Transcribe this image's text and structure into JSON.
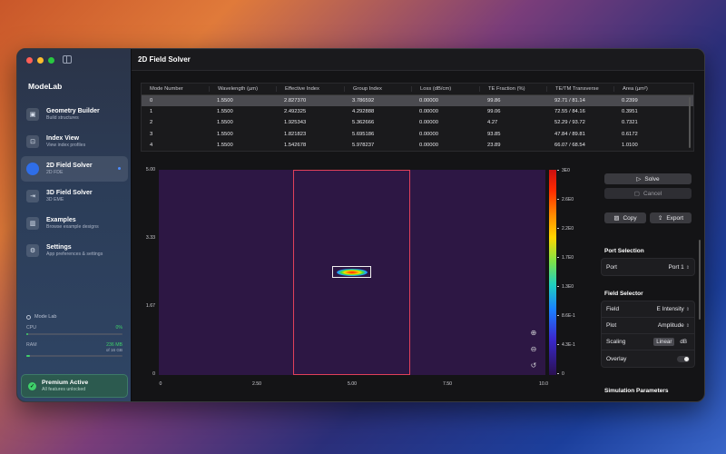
{
  "app": {
    "title": "ModeLab"
  },
  "sidebar": {
    "items": [
      {
        "label": "Geometry Builder",
        "sub": "Build structures",
        "icon": "geometry-icon"
      },
      {
        "label": "Index View",
        "sub": "View index profiles",
        "icon": "index-icon"
      },
      {
        "label": "2D Field Solver",
        "sub": "2D FDE",
        "icon": "solver-icon",
        "active": true
      },
      {
        "label": "3D Field Solver",
        "sub": "3D EME",
        "icon": "solver3d-icon"
      },
      {
        "label": "Examples",
        "sub": "Browse example designs",
        "icon": "examples-icon"
      },
      {
        "label": "Settings",
        "sub": "App preferences & settings",
        "icon": "gear-icon"
      }
    ],
    "monitor": {
      "title": "Mode Lab",
      "cpu_label": "CPU",
      "cpu_value": "0%",
      "cpu_fraction": 0.02,
      "ram_label": "RAM",
      "ram_value": "236 MB",
      "ram_total": "of 16 GB",
      "ram_fraction": 0.04
    },
    "premium": {
      "title": "Premium Active",
      "sub": "All features unlocked"
    }
  },
  "main": {
    "title": "2D Field Solver",
    "table": {
      "columns": [
        "Mode Number",
        "Wavelength (µm)",
        "Effective Index",
        "Group Index",
        "Loss (dB/cm)",
        "TE Fraction (%)",
        "TE/TM Transverse",
        "Area (µm²)"
      ],
      "rows": [
        [
          "0",
          "1.5500",
          "2.827370",
          "3.786592",
          "0.00000",
          "99.86",
          "92.71 / 81.14",
          "0.2399"
        ],
        [
          "1",
          "1.5500",
          "2.492325",
          "4.292888",
          "0.00000",
          "99.06",
          "72.55 / 84.16",
          "0.3951"
        ],
        [
          "2",
          "1.5500",
          "1.925343",
          "5.362666",
          "0.00000",
          "4.27",
          "52.29 / 93.72",
          "0.7321"
        ],
        [
          "3",
          "1.5500",
          "1.821823",
          "5.695186",
          "0.00000",
          "93.85",
          "47.84 / 89.81",
          "0.6172"
        ],
        [
          "4",
          "1.5500",
          "1.542678",
          "5.978237",
          "0.00000",
          "23.89",
          "66.07 / 68.54",
          "1.0100"
        ]
      ]
    },
    "plot": {
      "y_ticks": [
        "5.00",
        "3.33",
        "1.67",
        "0"
      ],
      "x_ticks": [
        "0",
        "2.50",
        "5.00",
        "7.50",
        "10.0"
      ],
      "colorbar_ticks": [
        "3E0",
        "2.6E0",
        "2.2E0",
        "1.7E0",
        "1.3E0",
        "8.6E-1",
        "4.3E-1",
        "0"
      ]
    },
    "panel": {
      "solve": "Solve",
      "cancel": "Cancel",
      "copy": "Copy",
      "export": "Export",
      "port_section": "Port Selection",
      "port_label": "Port",
      "port_value": "Port 1",
      "field_section": "Field Selector",
      "field_label": "Field",
      "field_value": "E Intensity",
      "plot_label": "Plot",
      "plot_value": "Amplitude",
      "scaling_label": "Scaling",
      "scaling_linear": "Linear",
      "scaling_db": "dB",
      "overlay_label": "Overlay",
      "sim_section": "Simulation Parameters"
    }
  }
}
